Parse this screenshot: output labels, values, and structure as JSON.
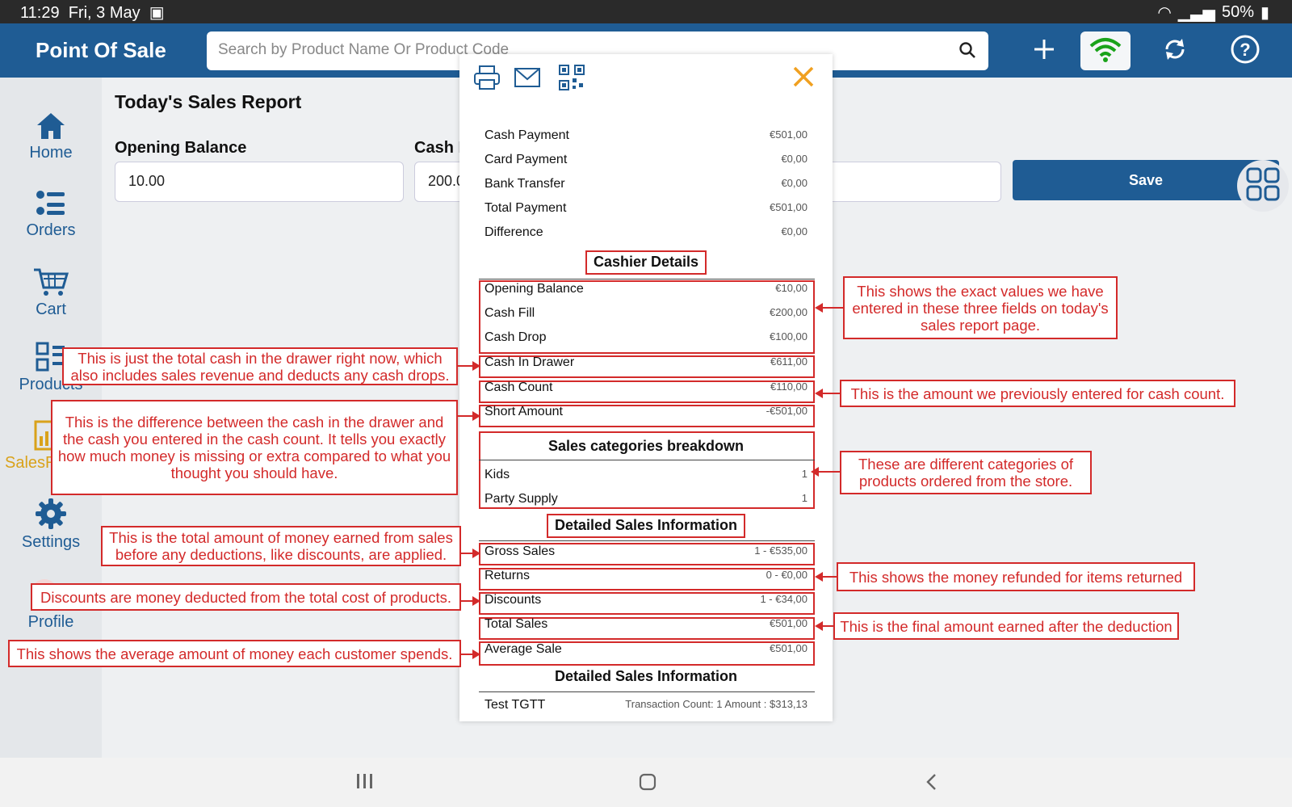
{
  "status_bar": {
    "time": "11:29",
    "date": "Fri, 3 May",
    "battery": "50%"
  },
  "app": {
    "title": "Point Of Sale",
    "search_placeholder": "Search by Product Name Or Product Code"
  },
  "sidebar": {
    "items": [
      {
        "label": "Home",
        "icon": "home-icon"
      },
      {
        "label": "Orders",
        "icon": "orders-icon"
      },
      {
        "label": "Cart",
        "icon": "cart-icon"
      },
      {
        "label": "Products",
        "icon": "products-icon"
      },
      {
        "label": "SalesR",
        "icon": "sales-report-icon"
      },
      {
        "label": "Settings",
        "icon": "gear-icon"
      },
      {
        "label": "Profile",
        "icon": "profile-icon"
      }
    ]
  },
  "page": {
    "title": "Today's Sales Report",
    "opening_balance_label": "Opening Balance",
    "opening_balance_value": "10.00",
    "cash_label": "Cash F",
    "cash_value": "200.0",
    "save_label": "Save"
  },
  "modal": {
    "payments": [
      {
        "label": "Cash Payment",
        "value": "€501,00"
      },
      {
        "label": "Card Payment",
        "value": "€0,00"
      },
      {
        "label": "Bank Transfer",
        "value": "€0,00"
      },
      {
        "label": "Total Payment",
        "value": "€501,00"
      },
      {
        "label": "Difference",
        "value": "€0,00"
      }
    ],
    "cashier_header": "Cashier Details",
    "cashier": [
      {
        "label": "Opening Balance",
        "value": "€10,00"
      },
      {
        "label": "Cash Fill",
        "value": "€200,00"
      },
      {
        "label": "Cash Drop",
        "value": "€100,00"
      },
      {
        "label": "Cash In Drawer",
        "value": "€611,00"
      },
      {
        "label": "Cash Count",
        "value": "€110,00"
      },
      {
        "label": "Short Amount",
        "value": "-€501,00"
      }
    ],
    "categories_header": "Sales categories breakdown",
    "categories": [
      {
        "label": "Kids",
        "value": "1"
      },
      {
        "label": "Party Supply",
        "value": "1"
      }
    ],
    "detailed_header": "Detailed Sales Information",
    "detailed": [
      {
        "label": "Gross Sales",
        "value": "1 - €535,00"
      },
      {
        "label": "Returns",
        "value": "0 - €0,00"
      },
      {
        "label": "Discounts",
        "value": "1 - €34,00"
      },
      {
        "label": "Total Sales",
        "value": "€501,00"
      },
      {
        "label": "Average Sale",
        "value": "€501,00"
      }
    ],
    "detailed_header_2": "Detailed Sales Information",
    "transactions": [
      {
        "label": "Test TGTT",
        "value": "Transaction Count: 1 Amount : $313,13"
      }
    ]
  },
  "annotations": {
    "three_fields": "This shows the exact values we have entered in these three fields on today's sales report page.",
    "cash_in_drawer": "This is just the total cash in the drawer right now, which also includes sales revenue and deducts any cash drops.",
    "cash_count": "This is the amount we previously entered for cash count.",
    "short_amount": "This is the difference between the cash in the drawer and the cash you entered in the cash count. It tells you exactly how much money is missing or extra compared to what you thought you should have.",
    "categories": "These are different categories of products ordered from the store.",
    "gross_sales": "This is the total amount of money earned from sales before any deductions, like discounts, are applied.",
    "returns": "This shows the money refunded for items returned",
    "discounts": "Discounts are money deducted from the total cost of products.",
    "total_sales": "This is the final amount earned after the deduction",
    "average_sale": "This shows the average amount of money each customer spends."
  },
  "colors": {
    "primary": "#1f5c94",
    "annotation": "#d32a2a",
    "close": "#f0a020"
  }
}
